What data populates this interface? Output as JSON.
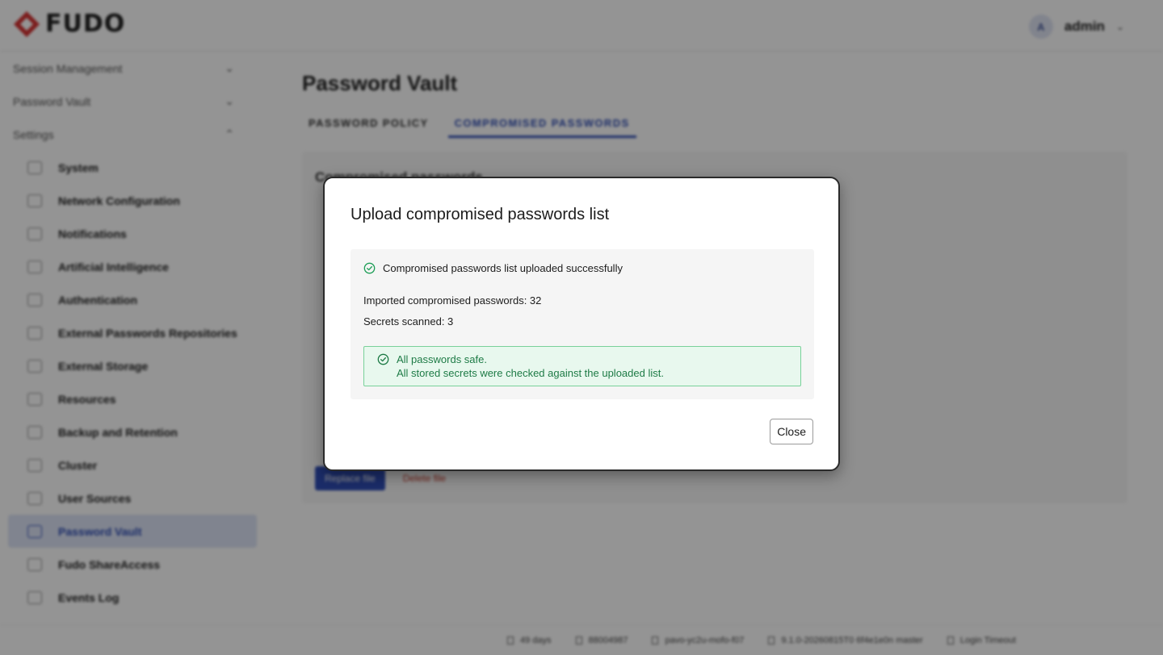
{
  "app": {
    "brand": "FUDO",
    "user": {
      "initial": "A",
      "name": "admin"
    }
  },
  "sidebar": {
    "groups": [
      {
        "label": "Session Management"
      },
      {
        "label": "Password Vault"
      },
      {
        "label": "Settings"
      }
    ],
    "items": [
      {
        "label": "System"
      },
      {
        "label": "Network Configuration"
      },
      {
        "label": "Notifications"
      },
      {
        "label": "Artificial Intelligence"
      },
      {
        "label": "Authentication"
      },
      {
        "label": "External Passwords Repositories"
      },
      {
        "label": "External Storage"
      },
      {
        "label": "Resources"
      },
      {
        "label": "Backup and Retention"
      },
      {
        "label": "Cluster"
      },
      {
        "label": "User Sources"
      },
      {
        "label": "Password Vault"
      },
      {
        "label": "Fudo ShareAccess"
      },
      {
        "label": "Events Log"
      }
    ],
    "active_item": "Password Vault"
  },
  "main": {
    "title": "Password Vault",
    "tabs": [
      {
        "label": "PASSWORD POLICY"
      },
      {
        "label": "COMPROMISED PASSWORDS"
      }
    ],
    "active_tab": "COMPROMISED PASSWORDS",
    "panel_title": "Compromised passwords",
    "replace_button": "Replace file",
    "delete_button": "Delete file"
  },
  "modal": {
    "title": "Upload compromised passwords list",
    "success_message": "Compromised passwords list uploaded successfully",
    "imported_line": "Imported compromised passwords: 32",
    "scanned_line": "Secrets scanned: 3",
    "safe_title": "All passwords safe.",
    "safe_description": "All stored secrets were checked against the uploaded list.",
    "close_label": "Close"
  },
  "footer": {
    "uptime": "49 days",
    "id": "88004987",
    "host": "pavo-yc2u-mofo-f07",
    "version": "9.1.0-20260815T0 6f4e1e0n master",
    "login_timeout": "Login Timeout"
  },
  "colors": {
    "accent": "#2f4db5",
    "success_text": "#1e7b46",
    "success_bg": "#e8f8ee",
    "success_border": "#79d19a",
    "brand_red": "#d63333"
  }
}
